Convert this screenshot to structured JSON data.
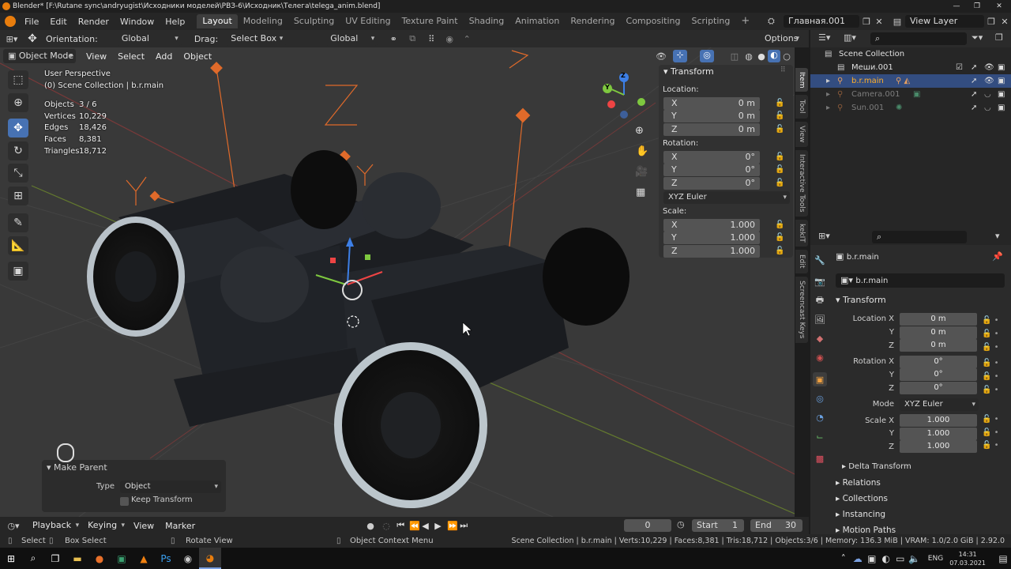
{
  "window": {
    "title": "Blender* [F:\\Rutane sync\\andryugist\\Исходники моделей\\РВЗ-6\\Исходник\\Телега\\telega_anim.blend]",
    "minimize": "—",
    "maximize": "❐",
    "close": "✕"
  },
  "topmenu": {
    "items": [
      "File",
      "Edit",
      "Render",
      "Window",
      "Help"
    ],
    "workspaces": [
      "Layout",
      "Modeling",
      "Sculpting",
      "UV Editing",
      "Texture Paint",
      "Shading",
      "Animation",
      "Rendering",
      "Compositing",
      "Scripting"
    ],
    "active_workspace": "Layout",
    "add_tab": "+",
    "scene": "Главная.001",
    "view_layer": "View Layer"
  },
  "toolbar": {
    "orientation_label": "Orientation:",
    "orientation_value": "Global",
    "drag_label": "Drag:",
    "drag_value": "Select Box",
    "transform_orientation": "Global",
    "options": "Options"
  },
  "viewport_header": {
    "mode": "Object Mode",
    "menus": [
      "View",
      "Select",
      "Add",
      "Object"
    ]
  },
  "overlay": {
    "perspective": "User Perspective",
    "collection": "(0) Scene Collection | b.r.main",
    "stats": [
      {
        "label": "Objects",
        "value": "3 / 6"
      },
      {
        "label": "Vertices",
        "value": "10,229"
      },
      {
        "label": "Edges",
        "value": "18,426"
      },
      {
        "label": "Faces",
        "value": "8,381"
      },
      {
        "label": "Triangles",
        "value": "18,712"
      }
    ],
    "empty_label_1": "Z",
    "empty_label_2": "Z",
    "empty_label_3": "Y",
    "empty_label_4": "Y"
  },
  "gizmo": {
    "z": "Z",
    "y": "Y",
    "x": "X"
  },
  "npanel": {
    "header": "Transform",
    "location_label": "Location:",
    "location": [
      {
        "axis": "X",
        "value": "0 m"
      },
      {
        "axis": "Y",
        "value": "0 m"
      },
      {
        "axis": "Z",
        "value": "0 m"
      }
    ],
    "rotation_label": "Rotation:",
    "rotation": [
      {
        "axis": "X",
        "value": "0°"
      },
      {
        "axis": "Y",
        "value": "0°"
      },
      {
        "axis": "Z",
        "value": "0°"
      }
    ],
    "rotation_mode": "XYZ Euler",
    "scale_label": "Scale:",
    "scale": [
      {
        "axis": "X",
        "value": "1.000"
      },
      {
        "axis": "Y",
        "value": "1.000"
      },
      {
        "axis": "Z",
        "value": "1.000"
      }
    ],
    "tabs": [
      "Item",
      "Tool",
      "View",
      "Interactive Tools",
      "kekIT",
      "Edit",
      "Screencast Keys"
    ]
  },
  "outliner": {
    "root": "Scene Collection",
    "rows": [
      {
        "name": "Меши.001",
        "selected": false
      },
      {
        "name": "b.r.main",
        "selected": true
      },
      {
        "name": "Camera.001",
        "selected": false
      },
      {
        "name": "Sun.001",
        "selected": false
      }
    ]
  },
  "properties": {
    "object_name": "b.r.main",
    "data_name": "b.r.main",
    "transform_header": "Transform",
    "location_label": "Location X",
    "location": [
      "0 m",
      "0 m",
      "0 m"
    ],
    "rotation_label": "Rotation X",
    "rotation": [
      "0°",
      "0°",
      "0°"
    ],
    "axis_y": "Y",
    "axis_z": "Z",
    "mode_label": "Mode",
    "mode_value": "XYZ Euler",
    "scale_label": "Scale X",
    "scale": [
      "1.000",
      "1.000",
      "1.000"
    ],
    "delta_transform": "Delta Transform",
    "relations": "Relations",
    "collections": "Collections",
    "instancing": "Instancing",
    "motion_paths": "Motion Paths"
  },
  "make_parent": {
    "header": "Make Parent",
    "type_label": "Type",
    "type_value": "Object",
    "keep_transform": "Keep Transform"
  },
  "timeline": {
    "menus": [
      "Playback",
      "Keying",
      "View",
      "Marker"
    ],
    "current_frame": "0",
    "start_label": "Start",
    "start_value": "1",
    "end_label": "End",
    "end_value": "30"
  },
  "statusbar": {
    "select": "Select",
    "box_select": "Box Select",
    "rotate_view": "Rotate View",
    "context_menu": "Object Context Menu",
    "info": "Scene Collection | b.r.main | Verts:10,229 | Faces:8,381 | Tris:18,712 | Objects:3/6 | Memory: 136.3 MiB | VRAM: 1.0/2.0 GiB | 2.92.0"
  },
  "taskbar": {
    "lang": "ENG",
    "time": "14:31",
    "date": "07.03.2021"
  },
  "colors": {
    "accent": "#4772b3",
    "selected_row": "#334d80",
    "empty_orange": "#e06a2a",
    "axis_x": "#ee4444",
    "axis_y": "#7ec83f",
    "axis_z": "#3d7fe6"
  }
}
